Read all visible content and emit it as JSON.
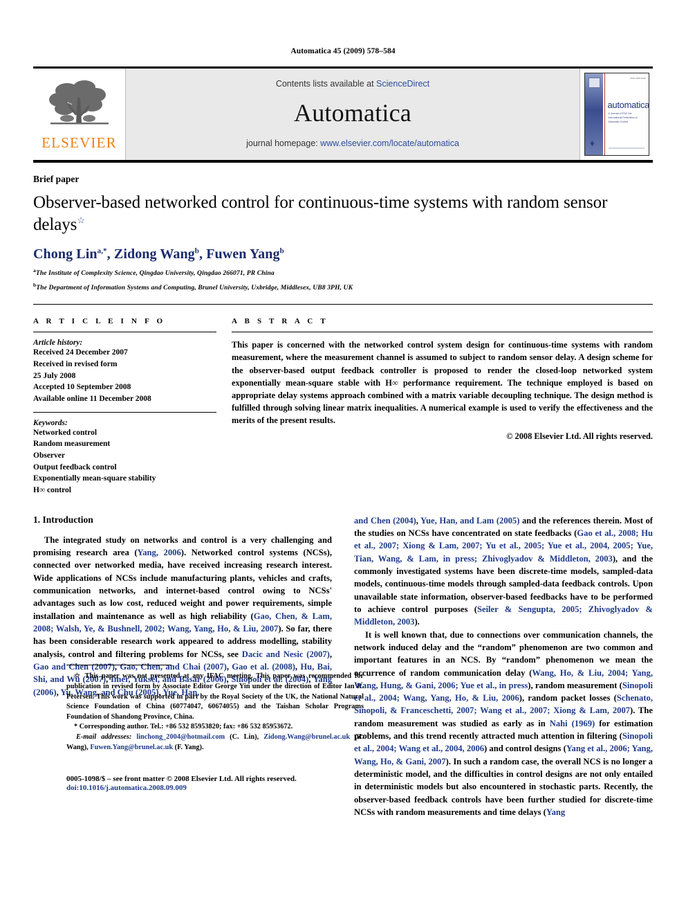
{
  "running_head": "Automatica 45 (2009) 578–584",
  "masthead": {
    "publisher_name": "ELSEVIER",
    "contents_prefix": "Contents lists available at ",
    "contents_link": "ScienceDirect",
    "journal_name": "Automatica",
    "homepage_prefix": "journal homepage: ",
    "homepage_url": "www.elsevier.com/locate/automatica",
    "cover": {
      "title": "automatica",
      "subtitle": "A Journal of IFAC the International Federation of Automatic Control",
      "issn": "ISSN 0005-1098"
    }
  },
  "article": {
    "type_label": "Brief paper",
    "title": "Observer-based networked control for continuous-time systems with random sensor delays",
    "title_star": "☆",
    "authors": [
      {
        "name": "Chong Lin",
        "sup": "a,*"
      },
      {
        "name": "Zidong Wang",
        "sup": "b"
      },
      {
        "name": "Fuwen Yang",
        "sup": "b"
      }
    ],
    "affiliations": [
      {
        "mark": "a",
        "text": "The Institute of Complexity Science, Qingdao University, Qingdao 266071, PR China"
      },
      {
        "mark": "b",
        "text": "The Department of Information Systems and Computing, Brunel University, Uxbridge, Middlesex, UB8 3PH, UK"
      }
    ]
  },
  "info": {
    "heading": "A R T I C L E   I N F O",
    "history_label": "Article history:",
    "history": [
      "Received 24 December 2007",
      "Received in revised form",
      "25 July 2008",
      "Accepted 10 September 2008",
      "Available online 11 December 2008"
    ],
    "keywords_label": "Keywords:",
    "keywords": [
      "Networked control",
      "Random measurement",
      "Observer",
      "Output feedback control",
      "Exponentially mean-square stability",
      "H∞ control"
    ]
  },
  "abstract": {
    "heading": "A B S T R A C T",
    "text": "This paper is concerned with the networked control system design for continuous-time systems with random measurement, where the measurement channel is assumed to subject to random sensor delay. A design scheme for the observer-based output feedback controller is proposed to render the closed-loop networked system exponentially mean-square stable with H∞ performance requirement. The technique employed is based on appropriate delay systems approach combined with a matrix variable decoupling technique. The design method is fulfilled through solving linear matrix inequalities. A numerical example is used to verify the effectiveness and the merits of the present results.",
    "copyright": "© 2008 Elsevier Ltd. All rights reserved."
  },
  "body": {
    "section_title": "1. Introduction",
    "left_paragraph_1_a": "The integrated study on networks and control is a very challenging and promising research area (",
    "left_cite_1": "Yang, 2006",
    "left_paragraph_1_b": "). Networked control systems (NCSs), connected over networked media, have received increasing research interest. Wide applications of NCSs include manufacturing plants, vehicles and crafts, communication networks, and internet-based control owing to NCSs' advantages such as low cost, reduced weight and power requirements, simple installation and maintenance as well as high reliability (",
    "left_cite_2": "Gao, Chen, & Lam, 2008; Walsh, Ye, & Bushnell, 2002; Wang, Yang, Ho, & Liu, 2007",
    "left_paragraph_1_c": "). So far, there has been considerable research work appeared to address modelling, stability analysis, control and filtering problems for NCSs, see ",
    "left_cite_3": "Dacic and Nesic (2007)",
    "left_sep_1": ", ",
    "left_cite_4": "Gao and Chen (2007)",
    "left_sep_2": ", ",
    "left_cite_5": "Gao, Chen, and Chai (2007)",
    "left_sep_3": ", ",
    "left_cite_6": "Gao et al. (2008)",
    "left_sep_4": ", ",
    "left_cite_7": "Hu, Bai, Shi, and Wu (2007)",
    "left_sep_5": ", ",
    "left_cite_8": "Imer, Yuksel, and Basar (2006)",
    "left_sep_6": ", ",
    "left_cite_9": "Sinopoli et al. (2004)",
    "left_sep_7": ", ",
    "left_cite_10": "Yang (2006)",
    "left_sep_8": ", ",
    "left_cite_11": "Yu, Wang, and Chu (2005)",
    "left_sep_9": ", ",
    "left_cite_12": "Yue, Han,",
    "right_cite_1": "and Chen (2004)",
    "right_sep_1": ", ",
    "right_cite_2": "Yue, Han, and Lam (2005)",
    "right_paragraph_1_a": " and the references therein. Most of the studies on NCSs have concentrated on state feedbacks (",
    "right_cite_3": "Gao et al., 2008; Hu et al., 2007; Xiong & Lam, 2007; Yu et al., 2005; Yue et al., 2004, 2005; Yue, Tian, Wang, & Lam, in press; Zhivoglyadov & Middleton, 2003",
    "right_paragraph_1_b": "), and the commonly investigated systems have been discrete-time models, sampled-data models, continuous-time models through sampled-data feedback controls. Upon unavailable state information, observer-based feedbacks have to be performed to achieve control purposes (",
    "right_cite_4": "Seiler & Sengupta, 2005; Zhivoglyadov & Middleton, 2003",
    "right_paragraph_1_c": ").",
    "right_paragraph_2_a": "It is well known that, due to connections over communication channels, the network induced delay and the “random” phenomenon are two common and important features in an NCS. By “random” phenomenon we mean the occurrence of random communication delay (",
    "right_cite_5": "Wang, Ho, & Liu, 2004; Yang, Wang, Hung, & Gani, 2006; Yue et al., in press",
    "right_paragraph_2_b": "), random measurement (",
    "right_cite_6": "Sinopoli et al., 2004; Wang, Yang, Ho, & Liu, 2006",
    "right_paragraph_2_c": "), random packet losses (",
    "right_cite_7": "Schenato, Sinopoli, & Franceschetti, 2007; Wang et al., 2007; Xiong & Lam, 2007",
    "right_paragraph_2_d": "). The random measurement was studied as early as in ",
    "right_cite_8": "Nahi (1969)",
    "right_paragraph_2_e": " for estimation problems, and this trend recently attracted much attention in filtering (",
    "right_cite_9": "Sinopoli et al., 2004; Wang et al., 2004, 2006",
    "right_paragraph_2_f": ") and control designs (",
    "right_cite_10": "Yang et al., 2006; Yang, Wang, Ho, & Gani, 2007",
    "right_paragraph_2_g": "). In such a random case, the overall NCS is no longer a deterministic model, and the difficulties in control designs are not only entailed in deterministic models but also encountered in stochastic parts. Recently, the observer-based feedback controls have been further studied for discrete-time NCSs with random measurements and time delays (",
    "right_cite_11": "Yang"
  },
  "footnotes": {
    "star_mark": "☆",
    "star_text": "This paper was not presented at any IFAC meeting. This paper was recommended for publication in revised form by Associate Editor George Yin under the direction of Editor Ian R. Petersen. This work was supported in part by the Royal Society of the UK, the National Natural Science Foundation of China (60774047, 60674055) and the Taishan Scholar Programs Foundation of Shandong Province, China.",
    "corr_mark": "*",
    "corr_text": "Corresponding author. Tel.: +86 532 85953820; fax: +86 532 85953672.",
    "email_label": "E-mail addresses:",
    "emails": [
      {
        "address": "linchong_2004@hotmail.com",
        "who": " (C. Lin),"
      },
      {
        "address": "Zidong.Wang@brunel.ac.uk",
        "who": " (Z. Wang),"
      },
      {
        "address": "Fuwen.Yang@brunel.ac.uk",
        "who": " (F. Yang)."
      }
    ]
  },
  "footer": {
    "issn_line": "0005-1098/$ – see front matter © 2008 Elsevier Ltd. All rights reserved.",
    "doi_line": "doi:10.1016/j.automatica.2008.09.009"
  }
}
